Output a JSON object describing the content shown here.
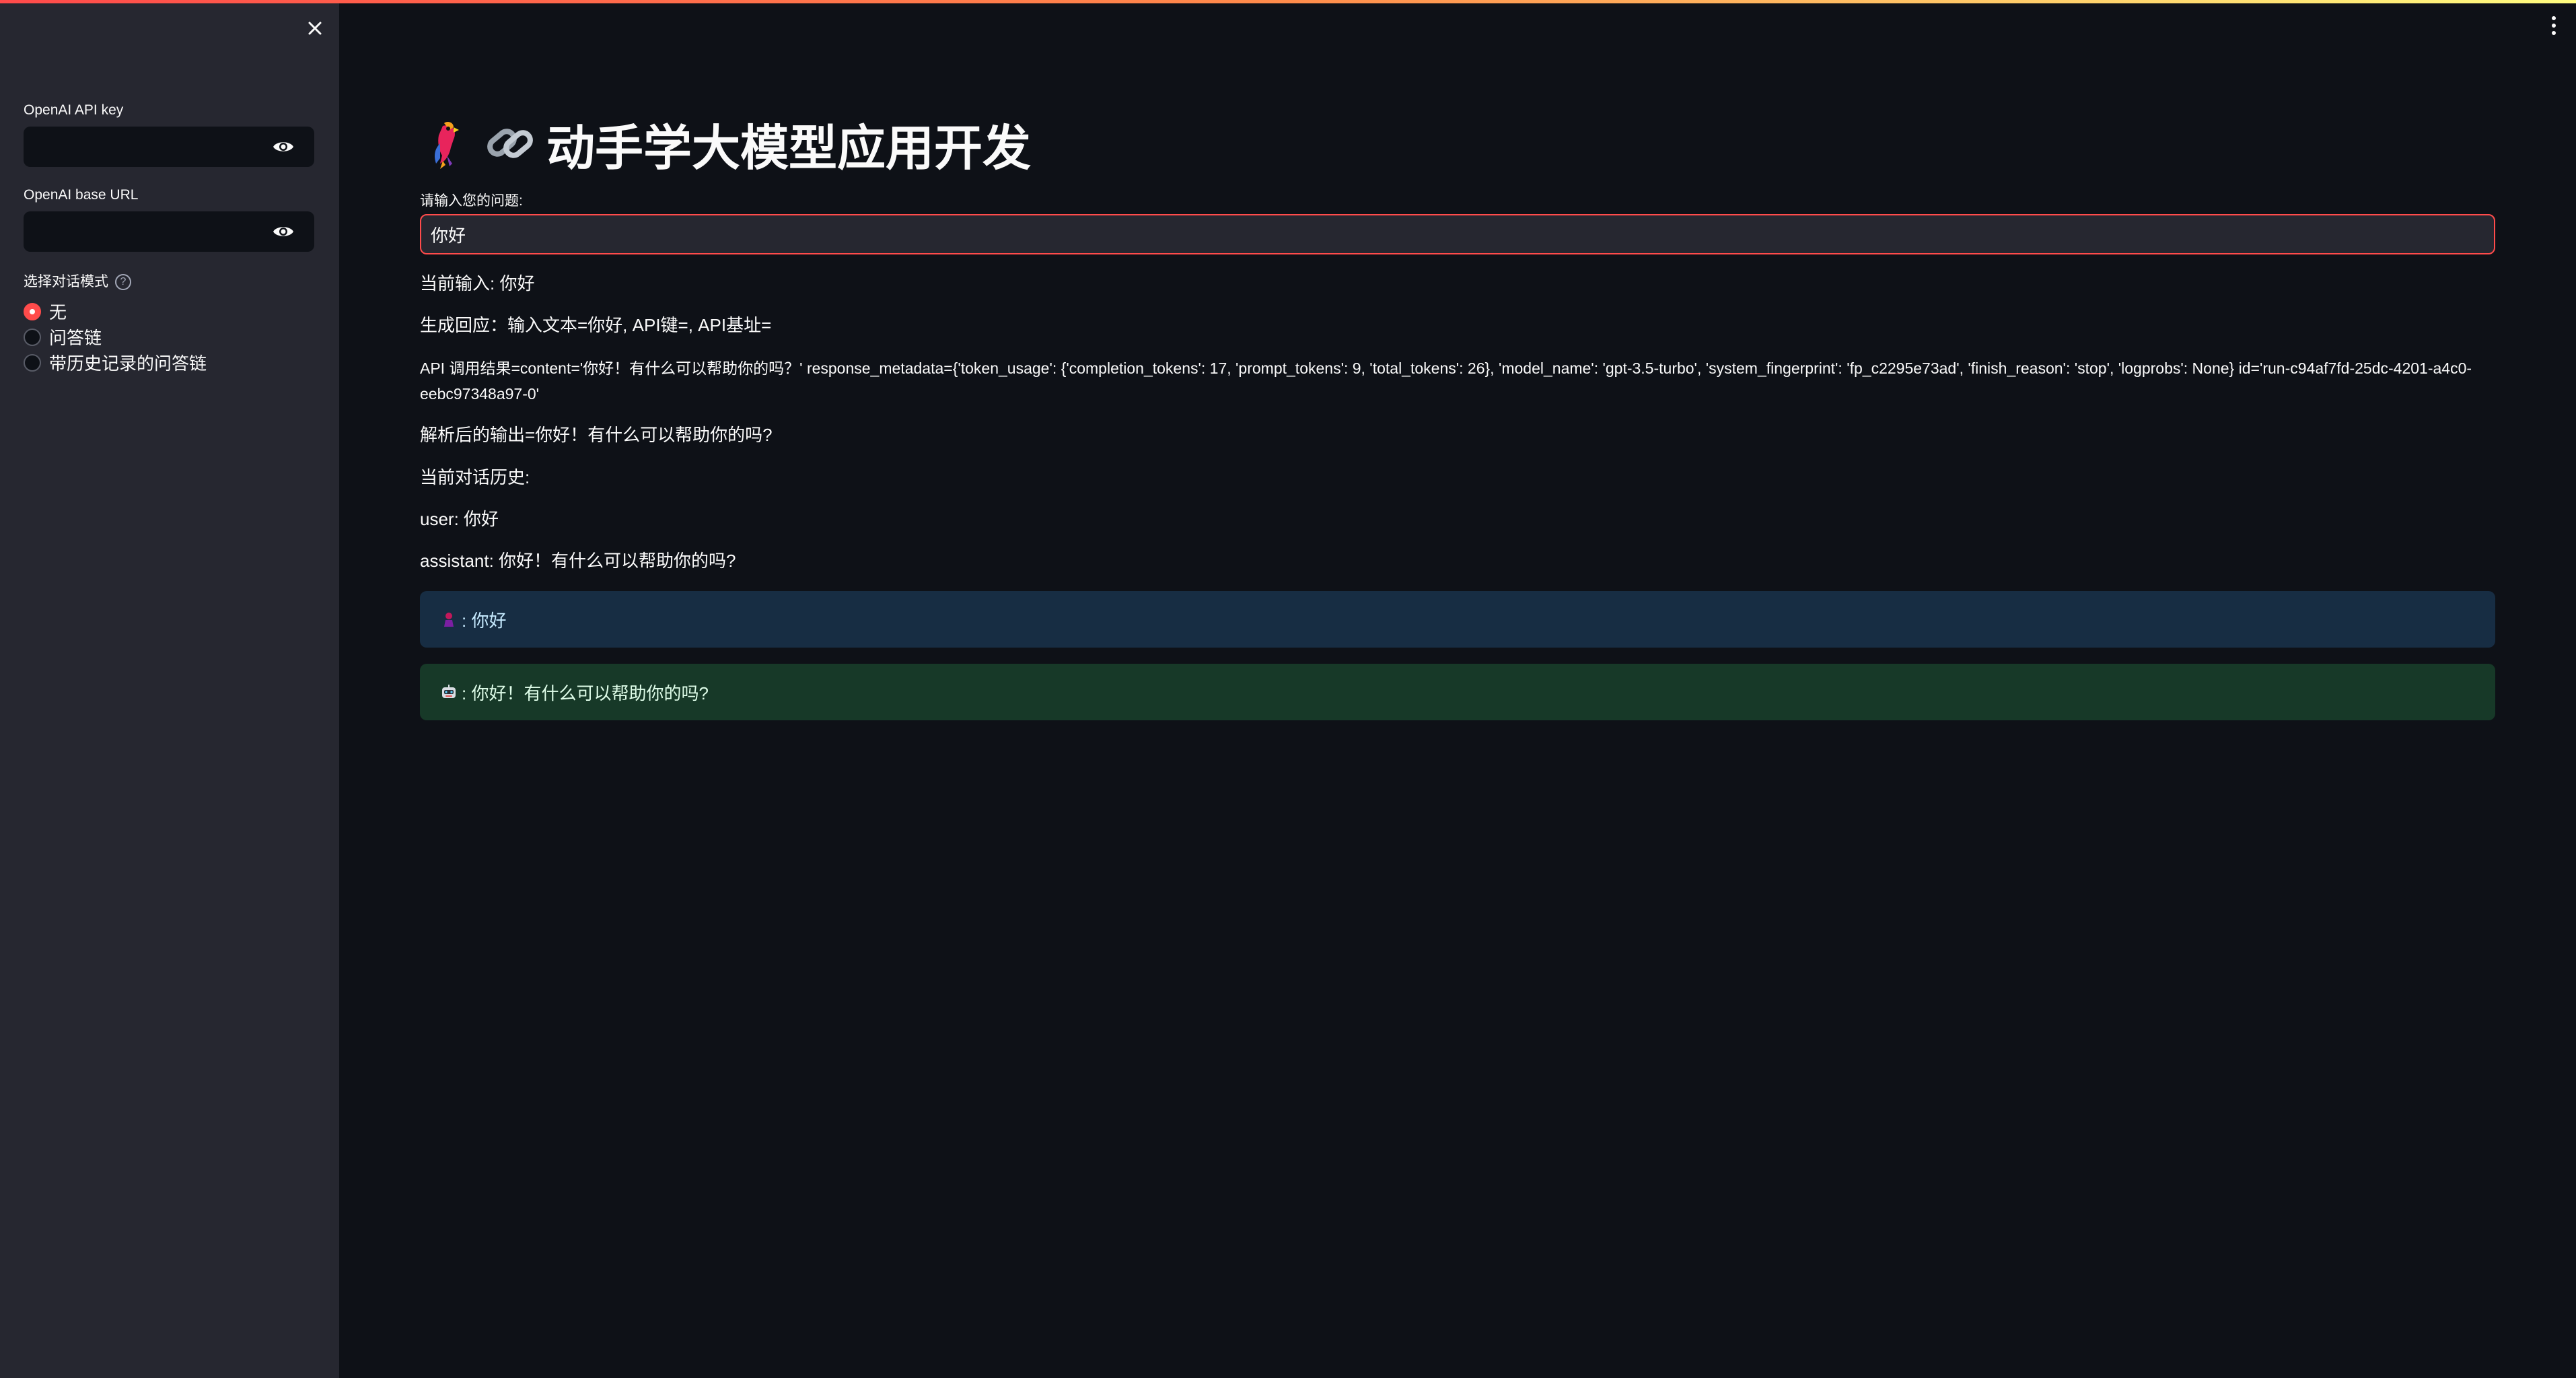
{
  "sidebar": {
    "api_key_label": "OpenAI API key",
    "api_key_value": "",
    "base_url_label": "OpenAI base URL",
    "base_url_value": "",
    "mode_label": "选择对话模式",
    "help_icon": "?",
    "modes": [
      {
        "label": "无",
        "selected": true
      },
      {
        "label": "问答链",
        "selected": false
      },
      {
        "label": "带历史记录的问答链",
        "selected": false
      }
    ]
  },
  "main": {
    "title": "动手学大模型应用开发",
    "title_icons": [
      "parrot-icon",
      "link-icon"
    ],
    "question_label": "请输入您的问题:",
    "question_value": "你好",
    "current_input": "当前输入: 你好",
    "generated_reply": "生成回应：输入文本=你好, API键=, API基址=",
    "api_result": "API 调用结果=content='你好！有什么可以帮助你的吗？' response_metadata={'token_usage': {'completion_tokens': 17, 'prompt_tokens': 9, 'total_tokens': 26}, 'model_name': 'gpt-3.5-turbo', 'system_fingerprint': 'fp_c2295e73ad', 'finish_reason': 'stop', 'logprobs': None} id='run-c94af7fd-25dc-4201-a4c0-eebc97348a97-0'",
    "parsed_output": "解析后的输出=你好！有什么可以帮助你的吗?",
    "history_label": "当前对话历史:",
    "history": [
      "user: 你好",
      "assistant: 你好！有什么可以帮助你的吗?"
    ],
    "chat": [
      {
        "role": "user",
        "icon": "person-icon",
        "text": ": 你好"
      },
      {
        "role": "assistant",
        "icon": "robot-icon",
        "text": ": 你好！有什么可以帮助你的吗?"
      }
    ]
  },
  "colors": {
    "accent": "#ff4b4b",
    "background": "#0e1117",
    "sidebar": "#262730",
    "user_msg_bg": "#172d43",
    "bot_msg_bg": "#173928"
  }
}
